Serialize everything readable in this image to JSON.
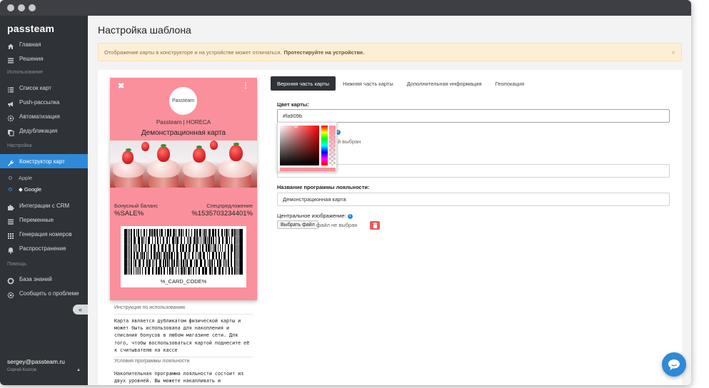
{
  "sidebar": {
    "logo": "passteam",
    "items": [
      {
        "label": "Главная"
      },
      {
        "label": "Решения"
      },
      {
        "label": "Список карт"
      },
      {
        "label": "Push-рассылка"
      },
      {
        "label": "Автоматизация"
      },
      {
        "label": "Дедубликация"
      },
      {
        "label": "Конструктор карт"
      },
      {
        "label": "Интеграции с CRM"
      },
      {
        "label": "Переменные"
      },
      {
        "label": "Генерация номеров"
      },
      {
        "label": "Распространение"
      },
      {
        "label": "База знаний"
      },
      {
        "label": "Сообщить о проблеме"
      }
    ],
    "sections": [
      "Использование",
      "Настройка",
      "Помощь"
    ],
    "subitems": [
      {
        "label": " Apple"
      },
      {
        "label": "◆ Google"
      }
    ],
    "collapse": "«",
    "user": {
      "email": "sergey@passteam.ru",
      "name": "Сергей Козлов",
      "caret": "▲"
    },
    "accent_color": "#2e8ad8"
  },
  "page": {
    "title": "Настройка шаблона",
    "alert": {
      "text": "Отображение карты в конструкторе и на устройстве может отличаться.",
      "link": "Протестируйте на устройстве.",
      "close": "×"
    }
  },
  "card": {
    "close": "✖",
    "menu": "⋮",
    "logo_text": "Passteam",
    "organization": "Passteam | HORECA",
    "program": "Демонстрационная карта",
    "left_label": "Бонусный баланс",
    "left_value": "%SALE%",
    "right_label": "Спецпредложение",
    "right_value": "%1535703234401%",
    "barcode_text": "%_CARD_CODE%",
    "color": "#fa909b"
  },
  "instructions": {
    "header": "Инструкция по использованию",
    "text": "Карта является дубликатом физической карты и может быть использована для накопления и списания бонусов в любом магазине сети. Для того, чтобы воспользоваться картой поднесите её к считывателю на кассе",
    "conditions_header": "Условия программы лояльности",
    "conditions_text": "Накопительная программа лояльности состоит из двух уровней. Вы можете накапливать и"
  },
  "tabs": [
    {
      "label": "Верхняя часть карты"
    },
    {
      "label": "Нижняя часть карты"
    },
    {
      "label": "Дополнительная информация"
    },
    {
      "label": "Геолокация"
    }
  ],
  "form": {
    "card_color_label": "Цвет карты:",
    "card_color_value": "#fa909b",
    "logo_file_status": "й выбран",
    "logo_tick": "i",
    "program_name_label": "Название программы лояльности:",
    "program_name_value": "Демонстрационная карта",
    "central_image_label": "Центральное изображение:",
    "info": "i",
    "choose_file": "Выбрать файл",
    "no_file": "файл не выбран"
  }
}
